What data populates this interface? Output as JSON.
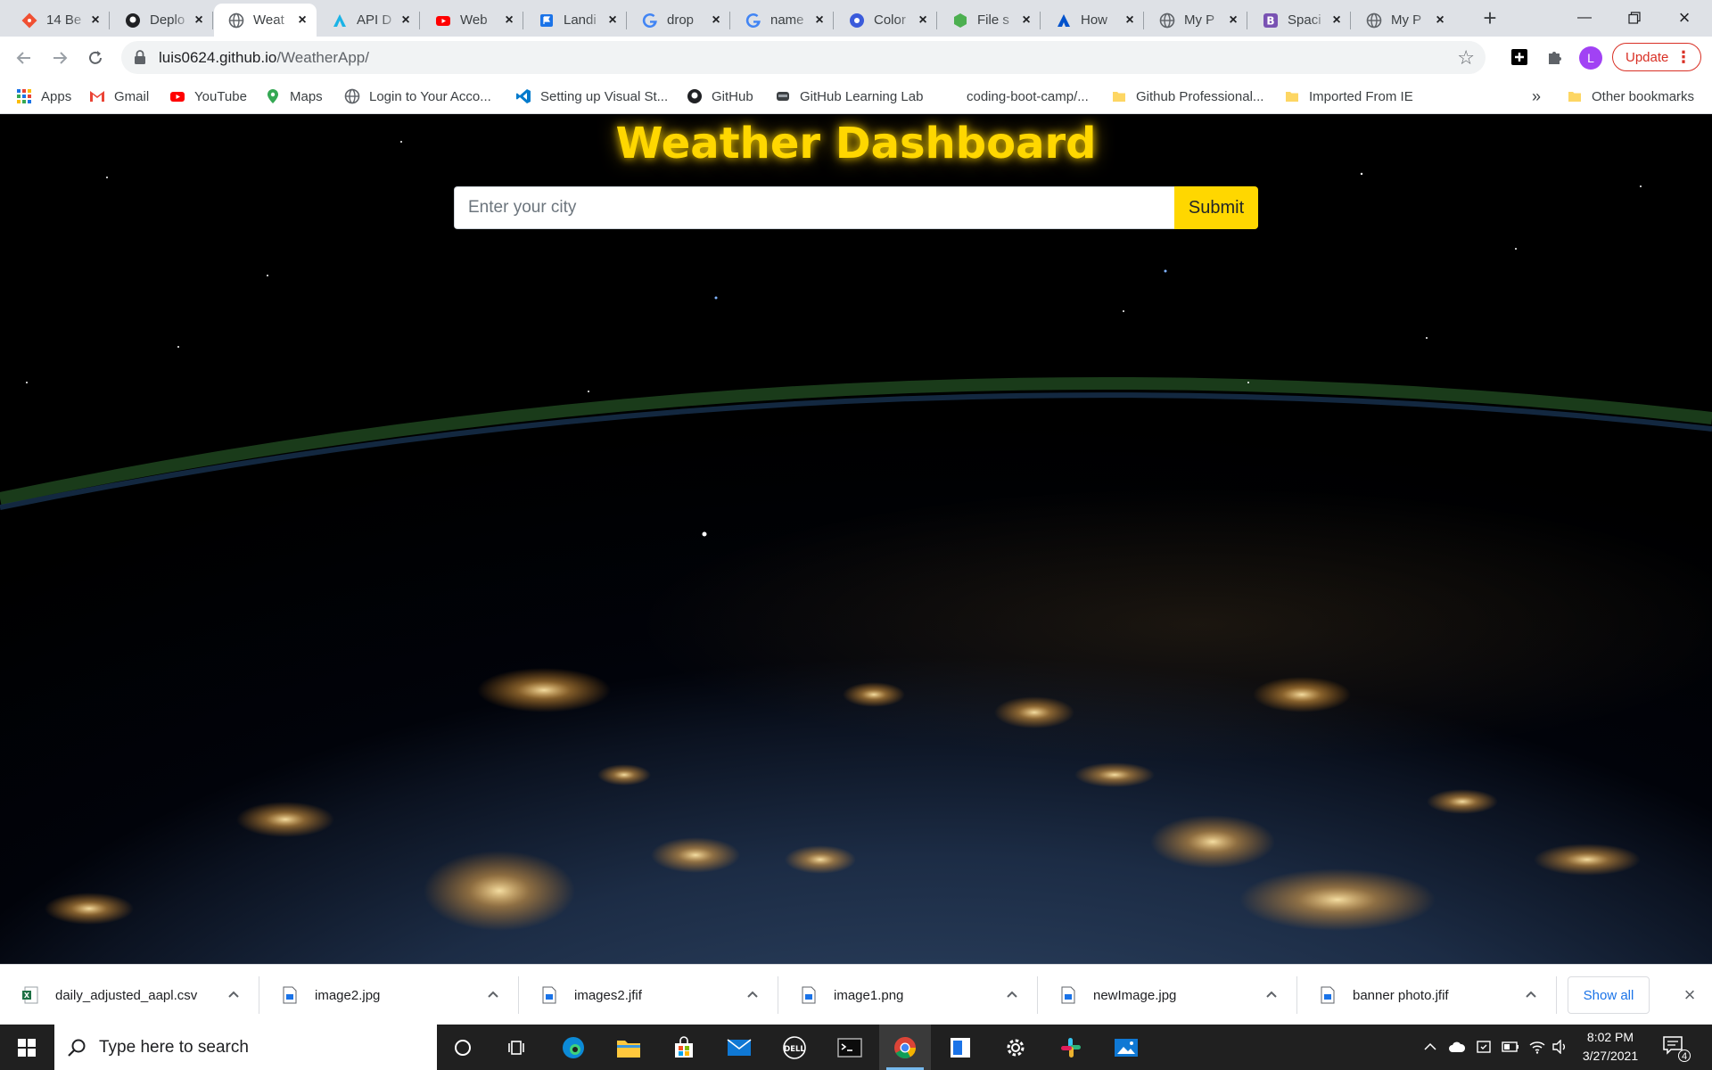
{
  "browser": {
    "tabs": [
      {
        "title": "14 Be",
        "favicon": "git-icon",
        "color": "#f05033"
      },
      {
        "title": "Deplo",
        "favicon": "github-icon",
        "color": "#202124"
      },
      {
        "title": "Weat",
        "favicon": "globe-icon",
        "color": "#5f6368",
        "active": true
      },
      {
        "title": "API D",
        "favicon": "api-icon",
        "color": "#1ab3e6"
      },
      {
        "title": "Web",
        "favicon": "youtube-icon",
        "color": "#ff0000"
      },
      {
        "title": "Landi",
        "favicon": "flag-icon",
        "color": "#1a73e8"
      },
      {
        "title": "drop",
        "favicon": "google-icon",
        "color": "#4285f4"
      },
      {
        "title": "name",
        "favicon": "google-icon",
        "color": "#4285f4"
      },
      {
        "title": "Color",
        "favicon": "colors-icon",
        "color": "#3b5bdb"
      },
      {
        "title": "File s",
        "favicon": "nodejs-icon",
        "color": "#4caf50"
      },
      {
        "title": "How",
        "favicon": "atlassian-icon",
        "color": "#0052cc"
      },
      {
        "title": "My P",
        "favicon": "globe-icon",
        "color": "#5f6368"
      },
      {
        "title": "Spaci",
        "favicon": "bootstrap-icon",
        "color": "#7952b3"
      },
      {
        "title": "My P",
        "favicon": "globe-icon",
        "color": "#5f6368"
      }
    ],
    "url_host": "luis0624.github.io",
    "url_path": "/WeatherApp/",
    "avatar_letter": "L",
    "update_label": "Update"
  },
  "bookmarks": {
    "items": [
      {
        "label": "Apps",
        "icon": "apps-grid-icon"
      },
      {
        "label": "Gmail",
        "icon": "gmail-icon"
      },
      {
        "label": "YouTube",
        "icon": "youtube-icon"
      },
      {
        "label": "Maps",
        "icon": "maps-icon"
      },
      {
        "label": "Login to Your Acco...",
        "icon": "globe-icon"
      },
      {
        "label": "Setting up Visual St...",
        "icon": "vscode-icon"
      },
      {
        "label": "GitHub",
        "icon": "github-icon"
      },
      {
        "label": "GitHub Learning Lab",
        "icon": "learning-lab-icon"
      },
      {
        "label": "coding-boot-camp/...",
        "icon": "none"
      },
      {
        "label": "Github Professional...",
        "icon": "folder-icon"
      },
      {
        "label": "Imported From IE",
        "icon": "folder-icon"
      }
    ],
    "overflow": "»",
    "other": "Other bookmarks"
  },
  "page": {
    "title": "Weather Dashboard",
    "search_placeholder": "Enter your city",
    "submit_label": "Submit",
    "accent": "#ffd700"
  },
  "downloads": {
    "items": [
      {
        "name": "daily_adjusted_aapl.csv",
        "icon": "excel-file-icon"
      },
      {
        "name": "image2.jpg",
        "icon": "image-file-icon"
      },
      {
        "name": "images2.jfif",
        "icon": "image-file-icon"
      },
      {
        "name": "image1.png",
        "icon": "image-file-icon"
      },
      {
        "name": "newImage.jpg",
        "icon": "image-file-icon"
      },
      {
        "name": "banner photo.jfif",
        "icon": "image-file-icon"
      }
    ],
    "show_all": "Show all"
  },
  "taskbar": {
    "search_placeholder": "Type here to search",
    "time": "8:02 PM",
    "date": "3/27/2021",
    "notification_count": "4"
  }
}
